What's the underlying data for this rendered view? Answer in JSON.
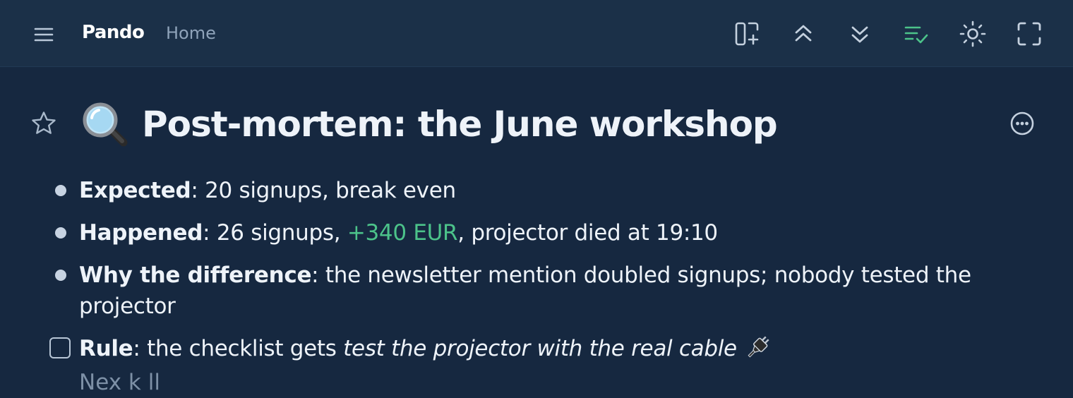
{
  "app": {
    "name": "Pando",
    "breadcrumb": "Home"
  },
  "toolbar": {
    "icons": [
      "menu-icon",
      "new-page-icon",
      "collapse-all-icon",
      "expand-all-icon",
      "checklist-icon",
      "sun-icon",
      "fullscreen-icon"
    ],
    "active_color": "#4cc38a"
  },
  "page": {
    "emoji": "magnifying-glass-emoji",
    "title": "Post-mortem: the June workshop",
    "favorite": false
  },
  "blocks": [
    {
      "type": "bullet",
      "label": "Expected",
      "text": ": 20 signups, break even"
    },
    {
      "type": "bullet",
      "label": "Happened",
      "text_before": ": 26 signups, ",
      "highlight": "+340 EUR",
      "text_after": ", projector died at 19:10"
    },
    {
      "type": "bullet",
      "label": "Why the difference",
      "text": ": the newsletter mention doubled signups; nobody tested the projector"
    },
    {
      "type": "todo",
      "checked": false,
      "label": "Rule",
      "text": ": the checklist gets ",
      "emphasis": "test the projector with the real cable",
      "emoji": "plug-emoji"
    }
  ],
  "cutoff_text": "Nex  k ll"
}
